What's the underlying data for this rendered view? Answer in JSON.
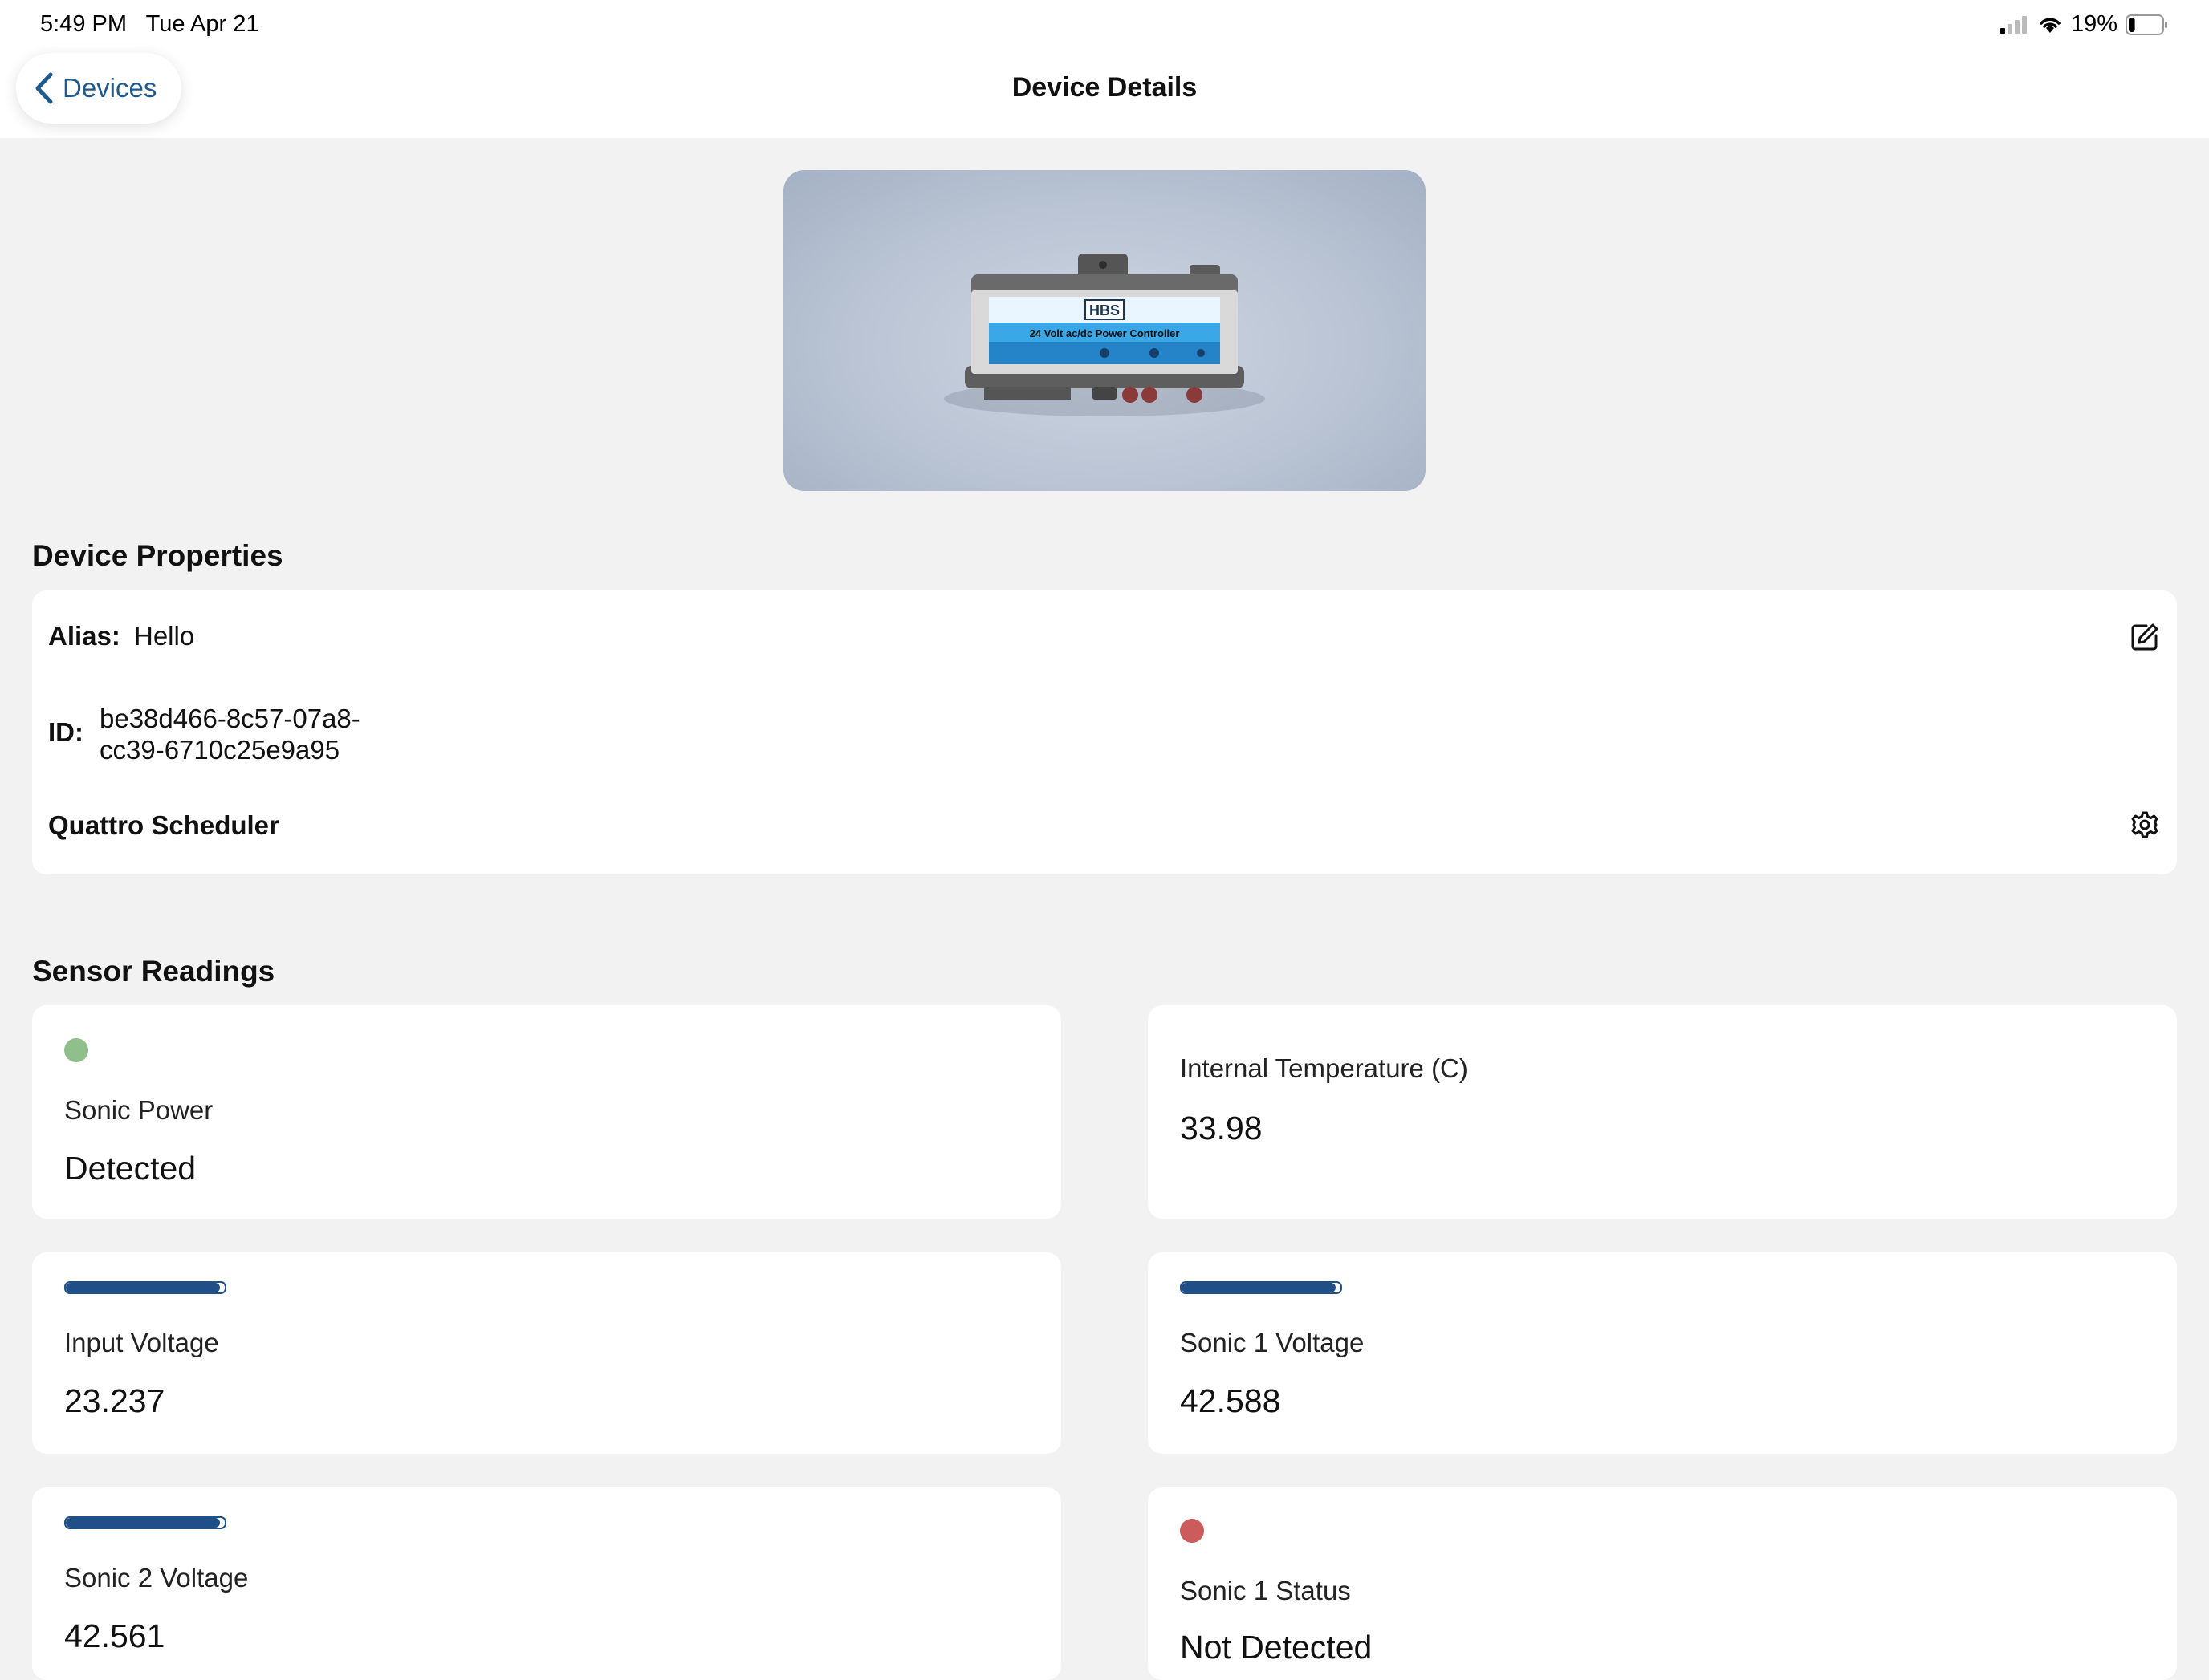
{
  "status_bar": {
    "time": "5:49 PM",
    "date": "Tue Apr 21",
    "battery_percent": "19%",
    "battery_level": 0.19
  },
  "nav": {
    "back_label": "Devices",
    "title": "Device Details"
  },
  "hero_image": {
    "brand": "HBS",
    "caption": "24 Volt ac/dc Power Controller"
  },
  "properties": {
    "title": "Device Properties",
    "alias_label": "Alias:",
    "alias_value": "Hello",
    "id_label": "ID:",
    "id_line1": "be38d466-8c57-07a8-",
    "id_line2": "cc39-6710c25e9a95",
    "scheduler_label": "Quattro Scheduler"
  },
  "sensors": {
    "title": "Sensor Readings",
    "items": [
      {
        "label": "Sonic Power",
        "value": "Detected",
        "indicator": "dot",
        "color": "#8fbf8a"
      },
      {
        "label": "Internal Temperature (C)",
        "value": "33.98",
        "indicator": "none"
      },
      {
        "label": "Input Voltage",
        "value": "23.237",
        "indicator": "bar",
        "level": 0.97
      },
      {
        "label": "Sonic 1 Voltage",
        "value": "42.588",
        "indicator": "bar",
        "level": 0.97
      },
      {
        "label": "Sonic 2 Voltage",
        "value": "42.561",
        "indicator": "bar",
        "level": 0.97
      },
      {
        "label": "Sonic 1 Status",
        "value": "Not Detected",
        "indicator": "dot",
        "color": "#cc5b5b"
      }
    ]
  },
  "icons": {
    "back": "chevron-left-icon",
    "edit": "edit-icon",
    "settings": "gear-icon",
    "wifi": "wifi-icon",
    "signal": "cellular-signal-icon",
    "battery": "battery-icon"
  }
}
